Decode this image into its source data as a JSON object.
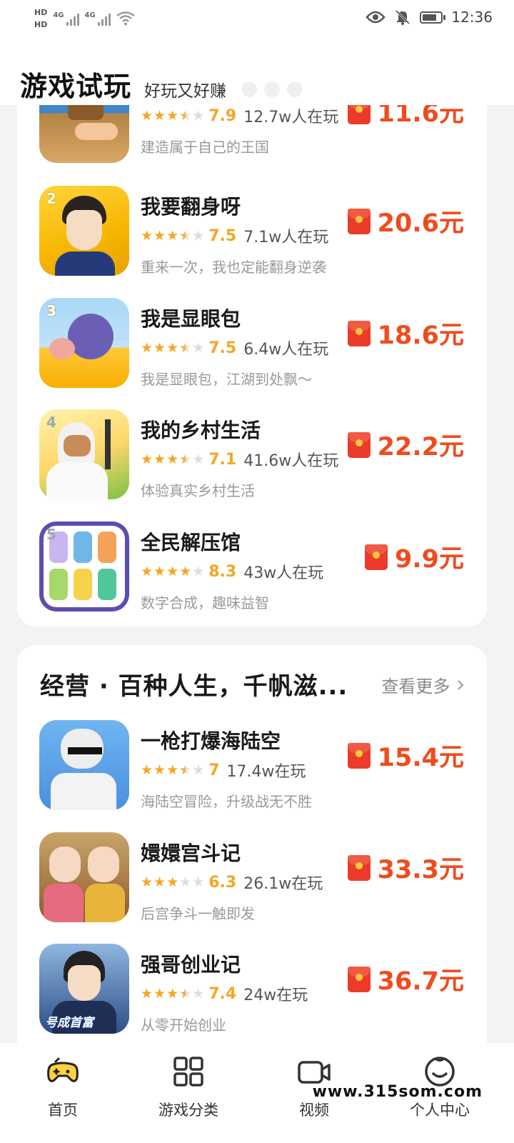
{
  "status_bar": {
    "hd1": "HD",
    "hd2": "HD",
    "net1": "4G",
    "net2": "4G",
    "time": "12:36",
    "icons": [
      "eye-icon",
      "bell-off-icon",
      "battery-icon",
      "wifi-icon",
      "signal-icon"
    ]
  },
  "header": {
    "title": "游戏试玩",
    "subtitle": "好玩又好赚"
  },
  "top_list": {
    "items": [
      {
        "rank": "",
        "name": "",
        "rating": "7.9",
        "stars": 3.5,
        "players": "12.7w人在玩",
        "desc": "建造属于自己的王国",
        "reward": "11.6元"
      },
      {
        "rank": "2",
        "name": "我要翻身呀",
        "rating": "7.5",
        "stars": 3.5,
        "players": "7.1w人在玩",
        "desc": "重来一次，我也定能翻身逆袭",
        "reward": "20.6元"
      },
      {
        "rank": "3",
        "name": "我是显眼包",
        "rating": "7.5",
        "stars": 3.5,
        "players": "6.4w人在玩",
        "desc": "我是显眼包，江湖到处飘～",
        "reward": "18.6元"
      },
      {
        "rank": "4",
        "name": "我的乡村生活",
        "rating": "7.1",
        "stars": 3.5,
        "players": "41.6w人在玩",
        "desc": "体验真实乡村生活",
        "reward": "22.2元"
      },
      {
        "rank": "5",
        "name": "全民解压馆",
        "rating": "8.3",
        "stars": 4,
        "players": "43w人在玩",
        "desc": "数字合成，趣味益智",
        "reward": "9.9元"
      }
    ]
  },
  "section2": {
    "title": "经营 · 百种人生，千帆滋...",
    "see_more": "查看更多",
    "items": [
      {
        "name": "一枪打爆海陆空",
        "rating": "7",
        "stars": 3.5,
        "players": "17.4w在玩",
        "desc": "海陆空冒险，升级战无不胜",
        "reward": "15.4元"
      },
      {
        "name": "嬛嬛宫斗记",
        "rating": "6.3",
        "stars": 3,
        "players": "26.1w在玩",
        "desc": "后宫争斗一触即发",
        "reward": "33.3元"
      },
      {
        "name": "强哥创业记",
        "rating": "7.4",
        "stars": 3.5,
        "players": "24w在玩",
        "desc": "从零开始创业",
        "reward": "36.7元",
        "thumb_text": "号成首富"
      }
    ]
  },
  "tabbar": {
    "tabs": [
      {
        "label": "首页",
        "icon": "gamepad-icon",
        "active": true
      },
      {
        "label": "游戏分类",
        "icon": "grid-icon",
        "active": false
      },
      {
        "label": "视频",
        "icon": "video-icon",
        "active": false
      },
      {
        "label": "个人中心",
        "icon": "smile-icon",
        "active": false
      }
    ]
  },
  "watermark": "www.315som.com",
  "colors": {
    "accent": "#f04b1e",
    "star": "#f5a623",
    "hongbao": "#ec3b2a",
    "active_tab": "#ffd23c"
  }
}
